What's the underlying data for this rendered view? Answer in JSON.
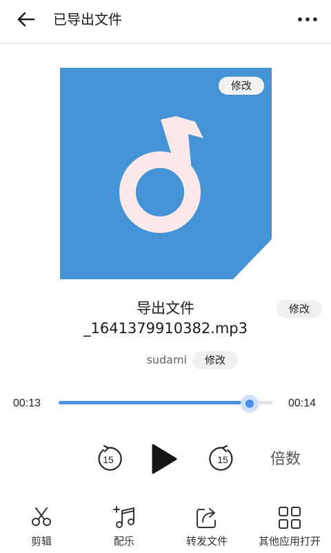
{
  "header": {
    "title": "已导出文件",
    "back_icon": "arrow-left-icon",
    "more_icon": "more-horizontal-icon"
  },
  "cover": {
    "edit_label": "修改",
    "background_color": "#4493d6",
    "note_color": "#fbe9e9",
    "icon": "music-note-icon"
  },
  "track": {
    "name_line1": "导出文件",
    "name_line2": "_1641379910382.mp3",
    "name_edit_label": "修改",
    "artist": "sudami",
    "artist_edit_label": "修改"
  },
  "player": {
    "current_time": "00:13",
    "total_time": "00:14",
    "progress": 0.89,
    "accent_color": "#4a8ee8",
    "rewind_seconds": "15",
    "forward_seconds": "15",
    "speed_label": "倍数"
  },
  "toolbar": {
    "items": [
      {
        "label": "剪辑",
        "icon": "scissors-icon"
      },
      {
        "label": "配乐",
        "icon": "music-add-icon"
      },
      {
        "label": "转发文件",
        "icon": "share-icon"
      },
      {
        "label": "其他应用打开",
        "icon": "apps-grid-icon"
      }
    ]
  }
}
